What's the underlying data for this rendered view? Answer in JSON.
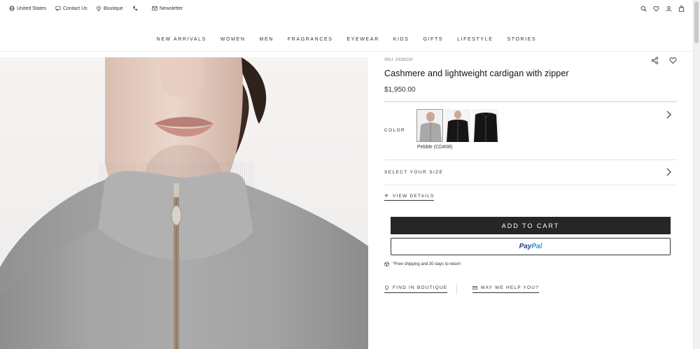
{
  "utility": {
    "country": "United States",
    "contact": "Contact Us",
    "boutique": "Boutique",
    "newsletter": "Newsletter"
  },
  "icons": {
    "globe": "globe-icon",
    "contact": "chat-icon",
    "boutique": "location-pin-icon",
    "phone": "phone-icon",
    "newsletter": "mail-icon",
    "search": "search-icon",
    "wishlist": "heart-icon",
    "account": "user-icon",
    "bag": "bag-icon"
  },
  "nav": [
    "NEW ARRIVALS",
    "WOMEN",
    "MEN",
    "FRAGRANCES",
    "EYEWEAR",
    "KIDS",
    "GIFTS",
    "LIFESTYLE",
    "STORIES"
  ],
  "product": {
    "sku": "SKU: 242M230",
    "title": "Cashmere and lightweight cardigan with zipper",
    "price": "$1,950.00",
    "color_label": "COLOR",
    "selected_color": "Pebble (CD408)",
    "swatches": [
      "Pebble",
      "Black",
      "Black"
    ],
    "size_label": "SELECT YOUR SIZE",
    "view_details": "VIEW DETAILS",
    "add_to_cart": "ADD TO CART",
    "paypal_a": "Pay",
    "paypal_b": "Pal",
    "shipping": "*Free shipping and 30 days to return",
    "find_in_boutique": "FIND IN BOUTIQUE",
    "help": "MAY WE HELP YOU?"
  },
  "colors": {
    "button_dark": "#262626",
    "paypal_blue_dark": "#253b80",
    "paypal_blue_light": "#179bd7"
  }
}
